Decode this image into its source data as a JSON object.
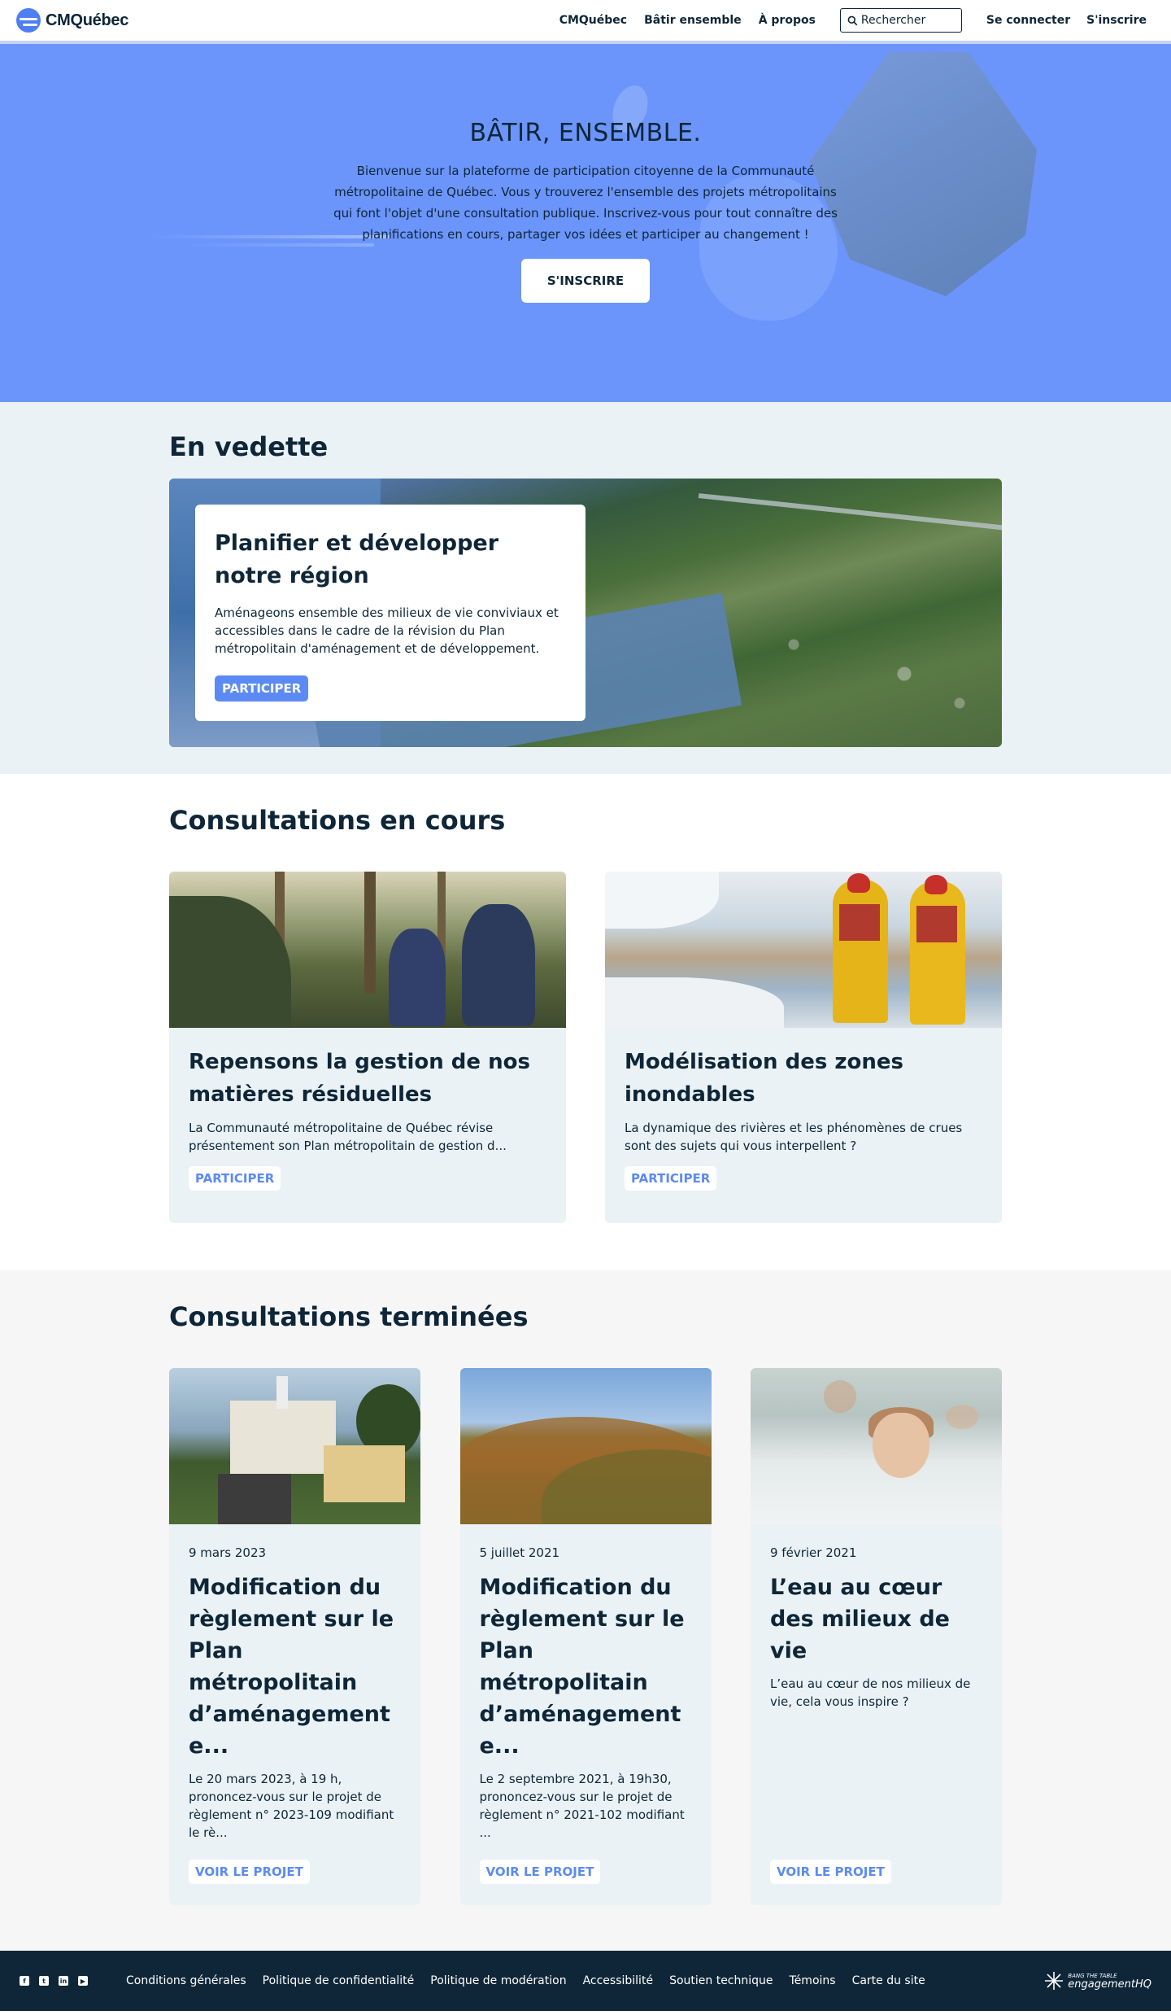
{
  "header": {
    "logo_text": "CMQuébec",
    "nav": [
      "CMQuébec",
      "Bâtir ensemble",
      "À propos"
    ],
    "search_placeholder": "Rechercher",
    "login": "Se connecter",
    "signup": "S'inscrire"
  },
  "hero": {
    "title": "BÂTIR, ENSEMBLE.",
    "text": "Bienvenue sur la plateforme de participation citoyenne de la Communauté métropolitaine de Québec. Vous y trouverez l'ensemble des projets métropolitains qui font l'objet d'une consultation publique. Inscrivez-vous pour tout connaître des planifications en cours, partager vos idées et participer au changement !",
    "button": "S'INSCRIRE"
  },
  "featured": {
    "section_title": "En vedette",
    "title": "Planifier et développer notre région",
    "text": "Aménageons ensemble des milieux de vie conviviaux et accessibles dans le cadre de la révision du Plan métropolitain d'aménagement et de développement.",
    "button": "PARTICIPER"
  },
  "current": {
    "section_title": "Consultations en cours",
    "cards": [
      {
        "title": "Repensons la gestion de nos matières résiduelles",
        "text": "La Communauté métropolitaine de Québec révise présentement son Plan métropolitain de gestion d...",
        "button": "PARTICIPER"
      },
      {
        "title": "Modélisation des zones inondables",
        "text": "La dynamique des rivières et les phénomènes de crues sont des sujets qui vous interpellent ?",
        "button": "PARTICIPER"
      }
    ]
  },
  "finished": {
    "section_title": "Consultations terminées",
    "cards": [
      {
        "date": "9 mars 2023",
        "title": "Modification du règlement sur le Plan métropolitain d’aménagement e...",
        "text": "Le 20 mars 2023, à 19 h, prononcez-vous sur le projet de règlement n° 2023-109 modifiant le rè...",
        "button": "VOIR LE PROJET"
      },
      {
        "date": "5 juillet 2021",
        "title": "Modification du règlement sur le Plan métropolitain d’aménagement e...",
        "text": "Le 2 septembre 2021, à 19h30, prononcez-vous sur le projet de règlement n° 2021-102 modifiant ...",
        "button": "VOIR LE PROJET"
      },
      {
        "date": "9 février 2021",
        "title": "L’eau au cœur des milieux de vie",
        "text": "L’eau au cœur de nos milieux de vie, cela vous inspire ?",
        "button": "VOIR LE PROJET"
      }
    ]
  },
  "footer": {
    "social_icons": [
      "facebook-icon",
      "twitter-icon",
      "linkedin-icon",
      "youtube-icon"
    ],
    "links": [
      "Conditions générales",
      "Politique de confidentialité",
      "Politique de modération",
      "Accessibilité",
      "Soutien technique",
      "Témoins",
      "Carte du site"
    ],
    "brand_small": "BANG THE TABLE",
    "brand": "engagementHQ"
  },
  "colors": {
    "primary_dark": "#0e2638",
    "accent_blue": "#5b8af5",
    "hero_blue": "#6b95fb",
    "section_light": "#eaf2f5"
  }
}
